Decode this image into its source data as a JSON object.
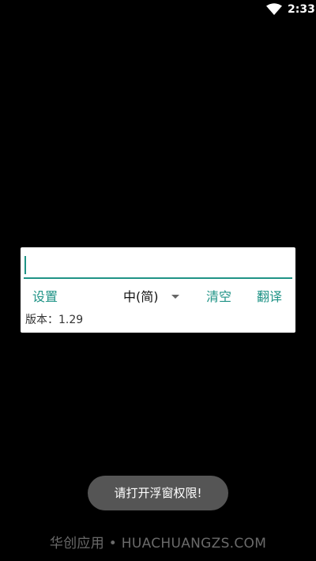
{
  "status_bar": {
    "time": "2:33",
    "wifi_icon": "wifi-icon"
  },
  "panel": {
    "input": {
      "value": "",
      "placeholder": ""
    },
    "settings_label": "设置",
    "language_selected": "中(简)",
    "clear_label": "清空",
    "translate_label": "翻译",
    "version_text": "版本：1.29"
  },
  "toast": {
    "message": "请打开浮窗权限!"
  },
  "watermark": {
    "text": "华创应用 • HUACHUANGZS.COM"
  },
  "colors": {
    "accent": "#1f9386",
    "background": "#000000",
    "toast_bg": "#555555"
  }
}
